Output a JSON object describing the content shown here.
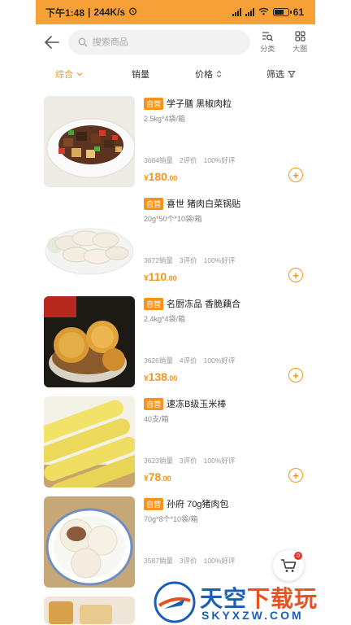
{
  "status_bar": {
    "time": "下午1:48",
    "speed": "244K/s",
    "battery_level": 0.61,
    "battery_text": "61"
  },
  "header": {
    "search_placeholder": "搜索商品",
    "category_label": "分类",
    "bigview_label": "大图"
  },
  "filters": {
    "items": [
      {
        "label": "综合",
        "active": true
      },
      {
        "label": "销量",
        "active": false
      },
      {
        "label": "价格",
        "active": false
      },
      {
        "label": "筛选",
        "active": false
      }
    ]
  },
  "colors": {
    "accent": "#f7941d",
    "status_bar": "#f7a035",
    "badge_red": "#e5322d"
  },
  "products": [
    {
      "badge": "自营",
      "title": "学子膳 黑椒肉粒",
      "spec": "2.5kg*4袋/箱",
      "sales": "3684销量",
      "reviews": "2评价",
      "rating": "100%好评",
      "currency": "¥",
      "price_int": "180",
      "price_dec": ".00"
    },
    {
      "badge": "自营",
      "title": "喜世 猪肉白菜锅贴",
      "spec": "20g*50个*10袋/箱",
      "sales": "3672销量",
      "reviews": "3评价",
      "rating": "100%好评",
      "currency": "¥",
      "price_int": "110",
      "price_dec": ".00"
    },
    {
      "badge": "自营",
      "title": "名厨冻品 香脆藕合",
      "spec": "2.4kg*4袋/箱",
      "sales": "3626销量",
      "reviews": "4评价",
      "rating": "100%好评",
      "currency": "¥",
      "price_int": "138",
      "price_dec": ".00"
    },
    {
      "badge": "自营",
      "title": "速冻B级玉米棒",
      "spec": "40支/箱",
      "sales": "3623销量",
      "reviews": "3评价",
      "rating": "100%好评",
      "currency": "¥",
      "price_int": "78",
      "price_dec": ".00"
    },
    {
      "badge": "自营",
      "title": "孙府 70g猪肉包",
      "spec": "70g*8个*10袋/箱",
      "sales": "3587销量",
      "reviews": "3评价",
      "rating": "100%好评",
      "currency": "",
      "price_int": "",
      "price_dec": ""
    }
  ],
  "cart": {
    "count": "0"
  },
  "watermark": {
    "cn_text": "天空下载站",
    "en_text": "SKYXZW.COM"
  }
}
